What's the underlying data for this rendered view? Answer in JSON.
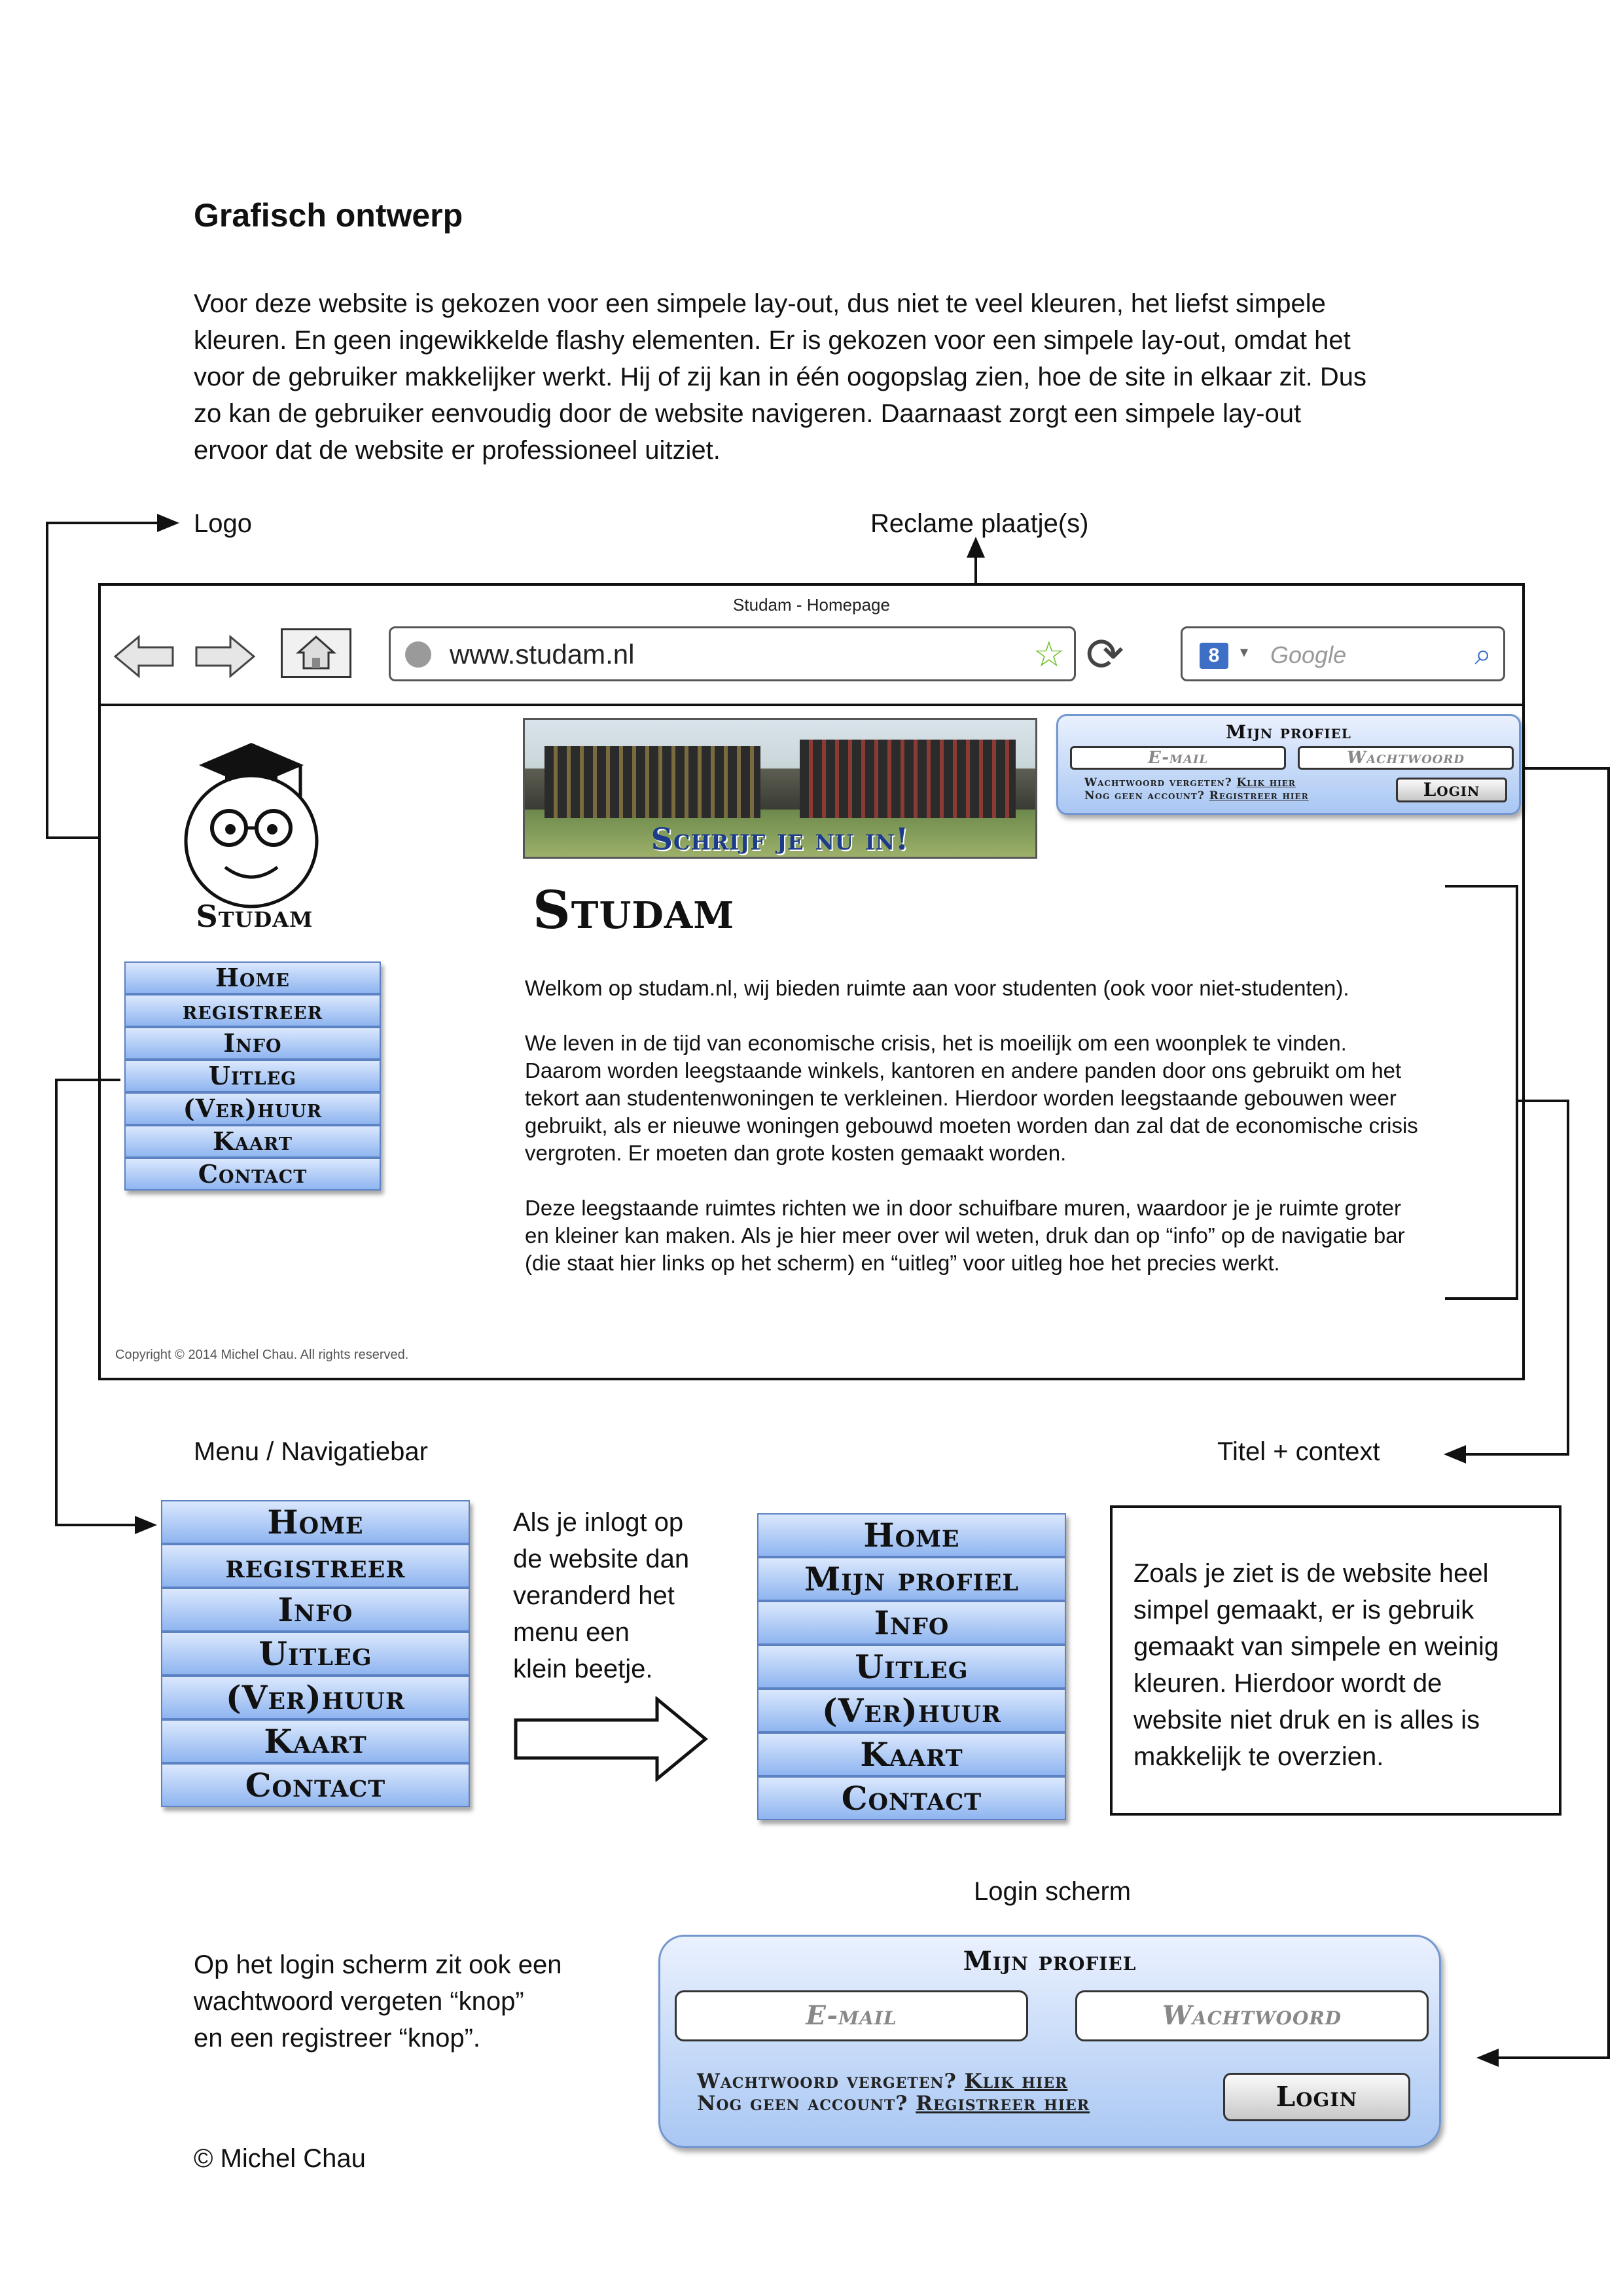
{
  "document": {
    "title": "Grafisch ontwerp",
    "intro": [
      "Voor deze website is gekozen voor een simpele lay-out, dus niet te veel kleuren, het liefst simpele",
      "kleuren. En geen ingewikkelde flashy elementen. Er is gekozen voor een simpele lay-out, omdat het",
      "voor de gebruiker makkelijker werkt. Hij of zij kan in één oogopslag zien, hoe de site in elkaar zit. Dus",
      "zo kan de gebruiker eenvoudig door de website navigeren. Daarnaast zorgt een simpele lay-out",
      "ervoor dat de website er professioneel uitziet."
    ],
    "labels": {
      "logo": "Logo",
      "reclame": "Reclame plaatje(s)",
      "menu": "Menu / Navigatiebar",
      "titel": "Titel + context",
      "login": "Login scherm"
    },
    "menu_note": [
      "Als je inlogt op",
      "de website dan",
      "veranderd het",
      "menu een",
      "klein beetje."
    ],
    "box_note": [
      "Zoals je ziet is de website heel",
      "simpel gemaakt, er is gebruik",
      "gemaakt van simpele en weinig",
      "kleuren. Hierdoor wordt de",
      "website niet druk en is alles is",
      "makkelijk te overzien."
    ],
    "login_note": [
      "Op het login scherm zit ook een",
      "wachtwoord vergeten “knop”",
      "en een registreer “knop”."
    ],
    "copyright": "© Michel Chau"
  },
  "browser": {
    "window_title": "Studam - Homepage",
    "url": "www.studam.nl",
    "search_placeholder": "Google",
    "search_badge": "8"
  },
  "site": {
    "logo_text": "Studam",
    "banner_text": "Schrijf je nu in!",
    "heading": "Studam",
    "paragraphs": [
      [
        "Welkom op studam.nl, wij bieden ruimte aan voor studenten (ook voor niet-studenten)."
      ],
      [
        "We leven in de tijd van economische crisis, het is moeilijk om een woonplek te vinden.",
        "Daarom worden leegstaande winkels, kantoren en andere panden door ons gebruikt om het",
        "tekort aan studentenwoningen te verkleinen. Hierdoor worden leegstaande gebouwen weer",
        "gebruikt, als er nieuwe woningen gebouwd moeten worden dan zal dat de economische crisis",
        "vergroten. Er moeten dan grote kosten gemaakt worden."
      ],
      [
        "Deze leegstaande ruimtes richten we in door schuifbare muren, waardoor je je ruimte groter",
        "en kleiner kan maken. Als je hier meer over wil weten, druk dan op “info” op de navigatie bar",
        "(die staat hier links op het scherm) en “uitleg” voor uitleg hoe het precies werkt."
      ]
    ],
    "footer": "Copyright © 2014 Michel Chau. All rights reserved."
  },
  "menus": {
    "site_menu": [
      "Home",
      "registreer",
      "Info",
      "Uitleg",
      "(Ver)huur",
      "Kaart",
      "Contact"
    ],
    "menu_before": [
      "Home",
      "registreer",
      "Info",
      "Uitleg",
      "(Ver)huur",
      "Kaart",
      "Contact"
    ],
    "menu_after": [
      "Home",
      "Mijn profiel",
      "Info",
      "Uitleg",
      "(Ver)huur",
      "Kaart",
      "Contact"
    ]
  },
  "login": {
    "title": "Mijn profiel",
    "email_placeholder": "E-mail",
    "password_placeholder": "Wachtwoord",
    "forgot_text": "Wachtwoord vergeten?",
    "forgot_link": "Klik hier",
    "noaccount_text": "Nog geen account?",
    "register_link": "Registreer hier",
    "button": "Login"
  }
}
